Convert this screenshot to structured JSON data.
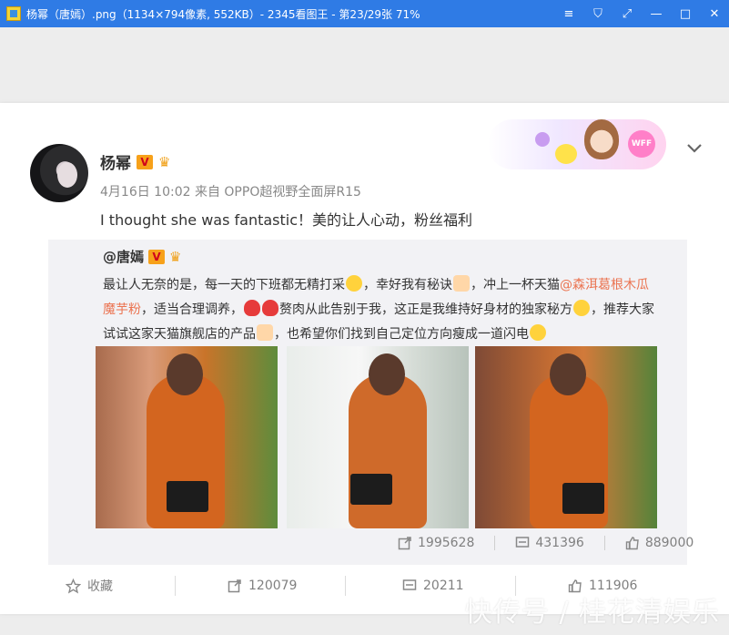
{
  "window": {
    "title": "杨幂（唐嫣）.png（1134×794像素, 552KB）- 2345看图王 - 第23/29张 71%",
    "controls": [
      "≡",
      "⛉",
      "⤢",
      "—",
      "□",
      "✕"
    ]
  },
  "post": {
    "user_name": "杨幂",
    "v_badge": "V",
    "meta": "4月16日 10:02 来自 OPPO超视野全面屏R15",
    "text": "I thought she was fantastic！美的让人心动，粉丝福利",
    "decor_label": "WFF"
  },
  "repost": {
    "user_name": "@唐嫣",
    "v_badge": "V",
    "text_1": "最让人无奈的是，每一天的下班都无精打采",
    "text_2": "，幸好我有秘诀",
    "text_3": "，冲上一杯天猫",
    "link": "@森洱葛根木瓜魔芋粉",
    "text_4": "，适当合理调养，",
    "text_5": "赘肉从此告别于我，这正是我维持好身材的独家秘方",
    "text_6": "，推荐大家试试这家天猫旗舰店的产品",
    "text_7": "，也希望你们找到自己定位方向瘦成一道闪电",
    "stats": {
      "reposts": "1995628",
      "comments": "431396",
      "likes": "889000"
    }
  },
  "actions": {
    "favorite": "收藏",
    "repost": "120079",
    "comment": "20211",
    "like": "111906"
  },
  "watermark": "快传号 / 桂花清娱乐"
}
